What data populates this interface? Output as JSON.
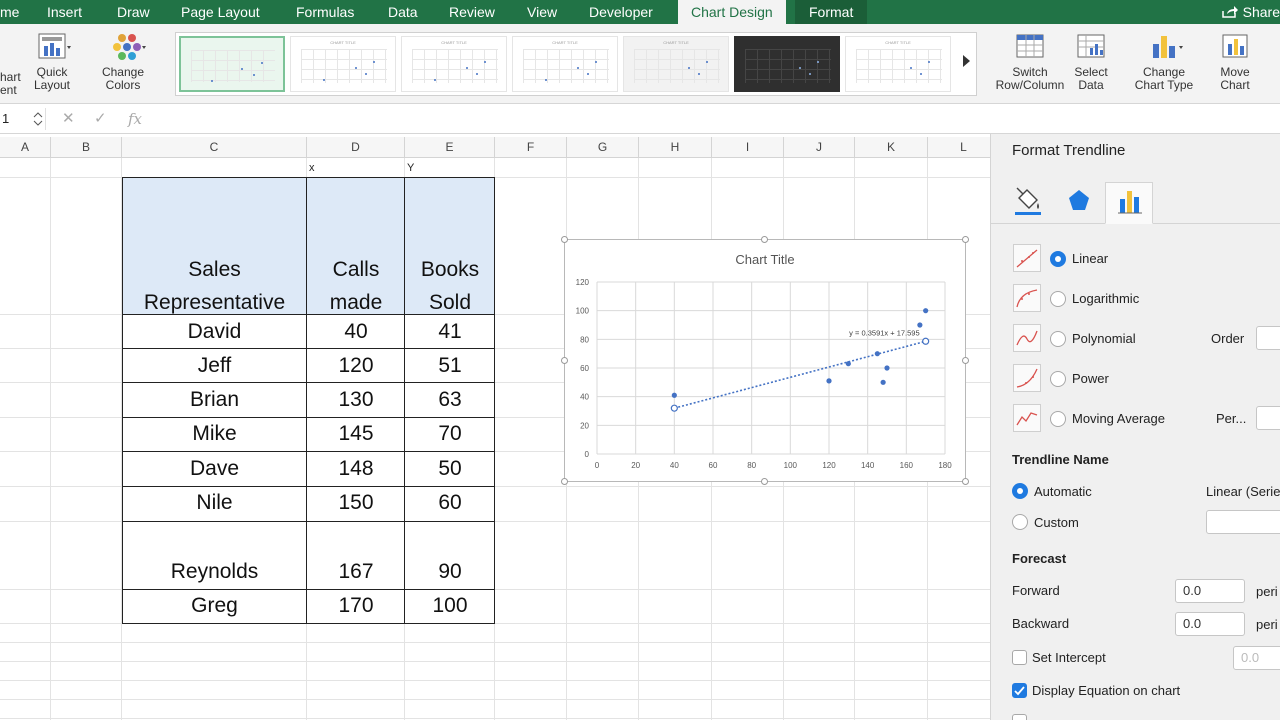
{
  "tabs": [
    "me",
    "Insert",
    "Draw",
    "Page Layout",
    "Formulas",
    "Data",
    "Review",
    "View",
    "Developer",
    "Chart Design",
    "Format"
  ],
  "share": "Share",
  "ribbon": {
    "add_chart_element": [
      "hart",
      "ent"
    ],
    "quick_layout": [
      "Quick",
      "Layout"
    ],
    "change_colors": [
      "Change",
      "Colors"
    ],
    "thumb_title": "CHART TITLE",
    "switch_row_col": [
      "Switch",
      "Row/Column"
    ],
    "select_data": [
      "Select",
      "Data"
    ],
    "change_chart_type": [
      "Change",
      "Chart Type"
    ],
    "move_chart": [
      "Move",
      "Chart"
    ]
  },
  "formula_bar": {
    "name_box": "1",
    "fx": "fx",
    "cancel": "✕",
    "enter": "✓"
  },
  "columns": [
    "A",
    "B",
    "C",
    "D",
    "E",
    "F",
    "G",
    "H",
    "I",
    "J",
    "K",
    "L"
  ],
  "sheet": {
    "label_x": "x",
    "label_y": "Y",
    "headers": [
      [
        "Sales",
        "Representative"
      ],
      [
        "Calls",
        "made"
      ],
      [
        "Books",
        "Sold"
      ]
    ],
    "rows": [
      {
        "name": "David",
        "calls": "40",
        "books": "41"
      },
      {
        "name": "Jeff",
        "calls": "120",
        "books": "51"
      },
      {
        "name": "Brian",
        "calls": "130",
        "books": "63"
      },
      {
        "name": "Mike",
        "calls": "145",
        "books": "70"
      },
      {
        "name": "Dave",
        "calls": "148",
        "books": "50"
      },
      {
        "name": "Nile",
        "calls": "150",
        "books": "60"
      },
      {
        "name": "Reynolds",
        "calls": "167",
        "books": "90"
      },
      {
        "name": "Greg",
        "calls": "170",
        "books": "100"
      }
    ]
  },
  "chart_data": {
    "type": "scatter",
    "title": "Chart Title",
    "x": [
      40,
      120,
      130,
      145,
      148,
      150,
      167,
      170
    ],
    "y": [
      41,
      51,
      63,
      70,
      50,
      60,
      90,
      100
    ],
    "xlim": [
      0,
      180
    ],
    "ylim": [
      0,
      120
    ],
    "xticks": [
      0,
      20,
      40,
      60,
      80,
      100,
      120,
      140,
      160,
      180
    ],
    "yticks": [
      0,
      20,
      40,
      60,
      80,
      100,
      120
    ],
    "grid": true,
    "trendline": {
      "type": "linear",
      "slope": 0.3591,
      "intercept": 17.595,
      "from": 40,
      "to": 170,
      "equation": "y = 0.3591x + 17.595"
    },
    "point_color": "#4472c4"
  },
  "pane": {
    "title": "Format Trendline",
    "trend_options": [
      {
        "label": "Linear",
        "selected": true
      },
      {
        "label": "Logarithmic",
        "selected": false
      },
      {
        "label": "Polynomial",
        "selected": false
      },
      {
        "label": "Power",
        "selected": false
      },
      {
        "label": "Moving Average",
        "selected": false
      }
    ],
    "order_label": "Order",
    "period_label": "Per...",
    "trendline_name": "Trendline Name",
    "automatic": "Automatic",
    "automatic_value": "Linear (Serie",
    "custom": "Custom",
    "forecast": "Forecast",
    "forward": "Forward",
    "forward_value": "0.0",
    "backward": "Backward",
    "backward_value": "0.0",
    "periods_suffix": "peri",
    "set_intercept": "Set Intercept",
    "intercept_value": "0.0",
    "display_equation": "Display Equation on chart"
  }
}
